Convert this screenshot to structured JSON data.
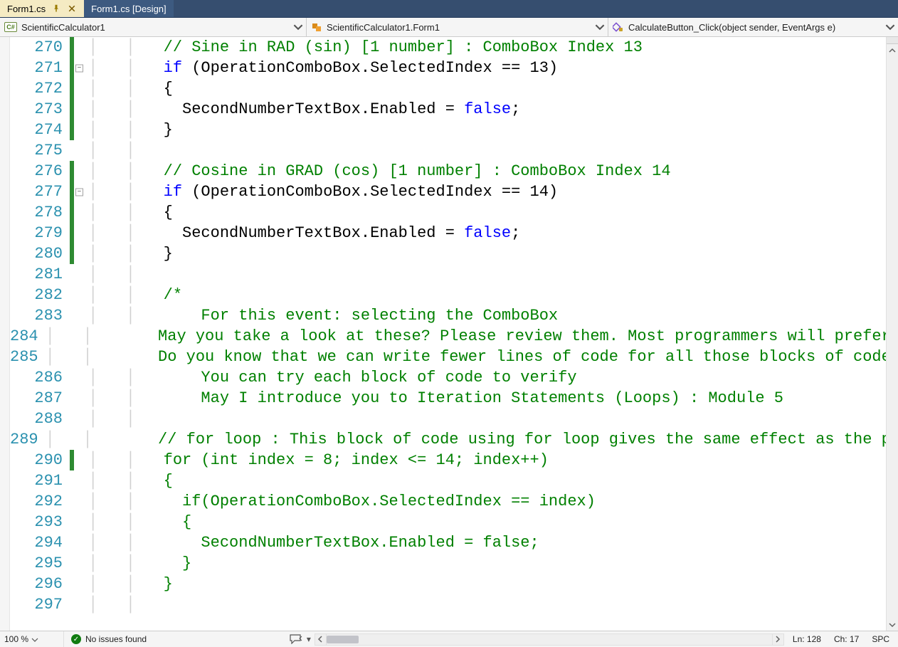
{
  "tabs": {
    "active": {
      "label": "Form1.cs"
    },
    "inactive": {
      "label": "Form1.cs [Design]"
    }
  },
  "nav": {
    "left_badge": "C#",
    "left_label": "ScientificCalculator1",
    "mid_label": "ScientificCalculator1.Form1",
    "right_label": "CalculateButton_Click(object sender, EventArgs e)"
  },
  "lines": [
    {
      "n": "270",
      "stripe": "green",
      "fold": "",
      "html": "<span class='tok-comment'>// Sine in RAD (sin) [1 number] : ComboBox Index 13</span>"
    },
    {
      "n": "271",
      "stripe": "green",
      "fold": "box",
      "html": "<span class='tok-keyword'>if</span> (OperationComboBox.SelectedIndex == 13)"
    },
    {
      "n": "272",
      "stripe": "green",
      "fold": "",
      "html": "{"
    },
    {
      "n": "273",
      "stripe": "green",
      "fold": "",
      "html": "  SecondNumberTextBox.Enabled = <span class='tok-keyword'>false</span>;"
    },
    {
      "n": "274",
      "stripe": "green",
      "fold": "",
      "html": "}"
    },
    {
      "n": "275",
      "stripe": "",
      "fold": "",
      "html": ""
    },
    {
      "n": "276",
      "stripe": "green",
      "fold": "",
      "html": "<span class='tok-comment'>// Cosine in GRAD (cos) [1 number] : ComboBox Index 14</span>"
    },
    {
      "n": "277",
      "stripe": "green",
      "fold": "box",
      "html": "<span class='tok-keyword'>if</span> (OperationComboBox.SelectedIndex == 14)"
    },
    {
      "n": "278",
      "stripe": "green",
      "fold": "",
      "html": "{"
    },
    {
      "n": "279",
      "stripe": "green",
      "fold": "",
      "html": "  SecondNumberTextBox.Enabled = <span class='tok-keyword'>false</span>;"
    },
    {
      "n": "280",
      "stripe": "green",
      "fold": "",
      "html": "}"
    },
    {
      "n": "281",
      "stripe": "",
      "fold": "",
      "html": ""
    },
    {
      "n": "282",
      "stripe": "",
      "fold": "",
      "html": "<span class='tok-comment'>/*</span>"
    },
    {
      "n": "283",
      "stripe": "",
      "fold": "",
      "html": "<span class='tok-comment'>    For this event: selecting the ComboBox</span>"
    },
    {
      "n": "284",
      "stripe": "",
      "fold": "",
      "html": "<span class='tok-comment'>    May you take a look at these? Please review them. Most programmers will prefer them</span>"
    },
    {
      "n": "285",
      "stripe": "",
      "fold": "",
      "html": "<span class='tok-comment'>    Do you know that we can write fewer lines of code for all those blocks of code we wrote for this event?</span>"
    },
    {
      "n": "286",
      "stripe": "",
      "fold": "",
      "html": "<span class='tok-comment'>    You can try each block of code to verify</span>"
    },
    {
      "n": "287",
      "stripe": "",
      "fold": "",
      "html": "<span class='tok-comment'>    May I introduce you to Iteration Statements (Loops) : Module 5</span>"
    },
    {
      "n": "288",
      "stripe": "",
      "fold": "",
      "html": ""
    },
    {
      "n": "289",
      "stripe": "",
      "fold": "",
      "html": "<span class='tok-comment'>    // for loop : This block of code using for loop gives the same effect as the previous blocks of code</span>"
    },
    {
      "n": "290",
      "stripe": "green",
      "fold": "",
      "html": "<span class='tok-comment'>for (int index = 8; index &lt;= 14; index++)</span>"
    },
    {
      "n": "291",
      "stripe": "",
      "fold": "",
      "html": "<span class='tok-comment'>{</span>"
    },
    {
      "n": "292",
      "stripe": "",
      "fold": "",
      "html": "<span class='tok-comment'>  if(OperationComboBox.SelectedIndex == index)</span>"
    },
    {
      "n": "293",
      "stripe": "",
      "fold": "",
      "html": "<span class='tok-comment'>  {</span>"
    },
    {
      "n": "294",
      "stripe": "",
      "fold": "",
      "html": "<span class='tok-comment'>    SecondNumberTextBox.Enabled = false;</span>"
    },
    {
      "n": "295",
      "stripe": "",
      "fold": "",
      "html": "<span class='tok-comment'>  }</span>"
    },
    {
      "n": "296",
      "stripe": "",
      "fold": "",
      "html": "<span class='tok-comment'>}</span>"
    },
    {
      "n": "297",
      "stripe": "",
      "fold": "",
      "html": ""
    }
  ],
  "status": {
    "zoom": "100 %",
    "issues": "No issues found",
    "line_label": "Ln: 128",
    "col_label": "Ch: 17",
    "mode": "SPC"
  }
}
